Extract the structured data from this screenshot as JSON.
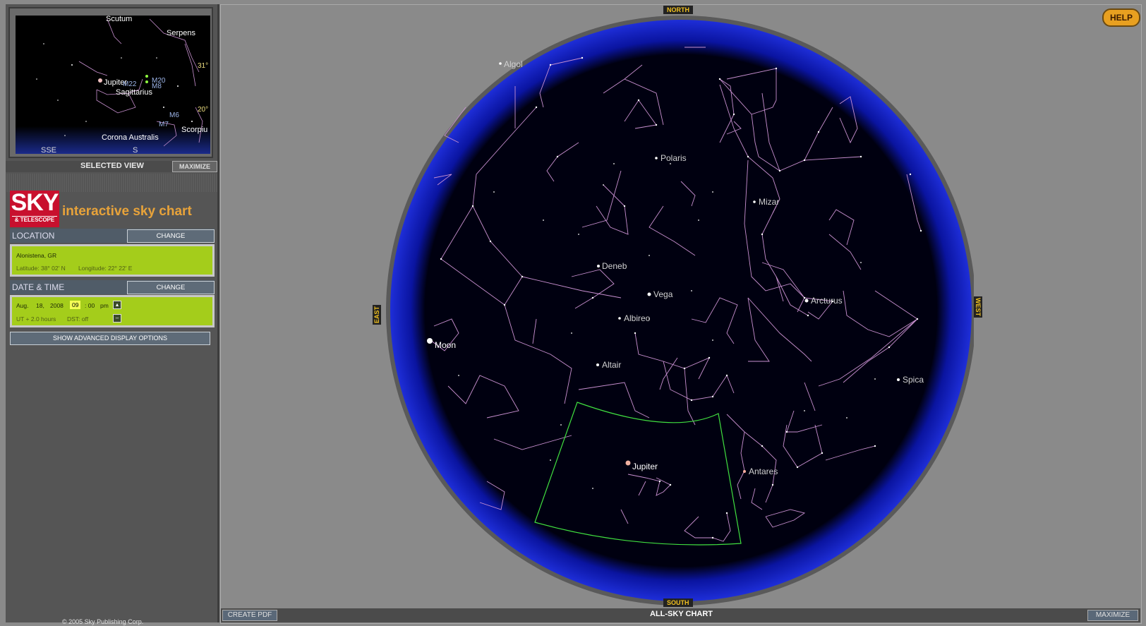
{
  "selected_view": {
    "label": "SELECTED VIEW",
    "maximize_label": "MAXIMIZE",
    "labels": {
      "scutum": "Scutum",
      "serpens": "Serpens",
      "jupiter": "Jupiter",
      "m22": "M22",
      "m20": "M20",
      "m8": "M8",
      "sagittarius": "Sagittarius",
      "m6": "M6",
      "m7": "M7",
      "corona": "Corona Australis",
      "scorpius": "Scorpiu",
      "alt31": "31°",
      "alt20": "20°",
      "sse": "SSE",
      "s": "S"
    }
  },
  "brand": {
    "logo_main": "SKY",
    "logo_sub": "& TELESCOPE",
    "title": "interactive sky chart"
  },
  "location": {
    "header": "LOCATION",
    "change_label": "CHANGE",
    "place": "Alonistena, GR",
    "latitude": "Latitude:  38° 02' N",
    "longitude": "Longitude:  22° 22' E"
  },
  "date_time": {
    "header": "DATE & TIME",
    "change_label": "CHANGE",
    "month": "Aug.",
    "day": "18,",
    "year": "2008",
    "hour": "09",
    "minute": ": 00",
    "ampm": "pm",
    "ut_offset": "UT + 2.0 hours",
    "dst": "DST:  off"
  },
  "advanced_label": "SHOW ADVANCED DISPLAY OPTIONS",
  "copyright": "© 2005 Sky Publishing Corp.",
  "sky_chart": {
    "directions": {
      "north": "NORTH",
      "south": "SOUTH",
      "east": "EAST",
      "west": "WEST"
    },
    "stars": {
      "algol": "Algol",
      "polaris": "Polaris",
      "mizar": "Mizar",
      "deneb": "Deneb",
      "vega": "Vega",
      "arcturus": "Arcturus",
      "albireo": "Albireo",
      "moon": "Moon",
      "altair": "Altair",
      "spica": "Spica",
      "jupiter": "Jupiter",
      "antares": "Antares"
    },
    "colors": {
      "horizon": "#1a2ad0",
      "sky": "#000000",
      "lines": "#c890d0",
      "view_box": "#40e040",
      "label": "#d8d8d8"
    }
  },
  "help_label": "HELP",
  "bottom_bar": {
    "create_pdf": "CREATE PDF",
    "title": "ALL-SKY CHART",
    "maximize": "MAXIMIZE"
  }
}
